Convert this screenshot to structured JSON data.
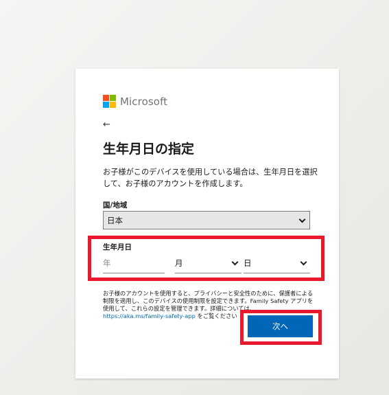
{
  "brand": {
    "name": "Microsoft"
  },
  "nav": {
    "back_icon": "←"
  },
  "page": {
    "title": "生年月日の指定",
    "description": "お子様がこのデバイスを使用している場合は、生年月日を選択して、お子様のアカウントを作成します。"
  },
  "country": {
    "label": "国/地域",
    "selected": "日本"
  },
  "dob": {
    "label": "生年月日",
    "year_placeholder": "年",
    "month_selected": "月",
    "day_selected": "日"
  },
  "info": {
    "text": "お子様のアカウントを使用すると、プライバシーと安全性のために、保護者による制限を適用し、このデバイスの使用制限を設定できます。Family Safety アプリを使用して、これらの設定を管理できます。詳細については、",
    "link_text": "https://aka.ms/family-safety-app",
    "suffix": " をご覧ください"
  },
  "actions": {
    "next_label": "次へ"
  },
  "colors": {
    "accent": "#0067b8",
    "highlight": "#e8192c"
  }
}
